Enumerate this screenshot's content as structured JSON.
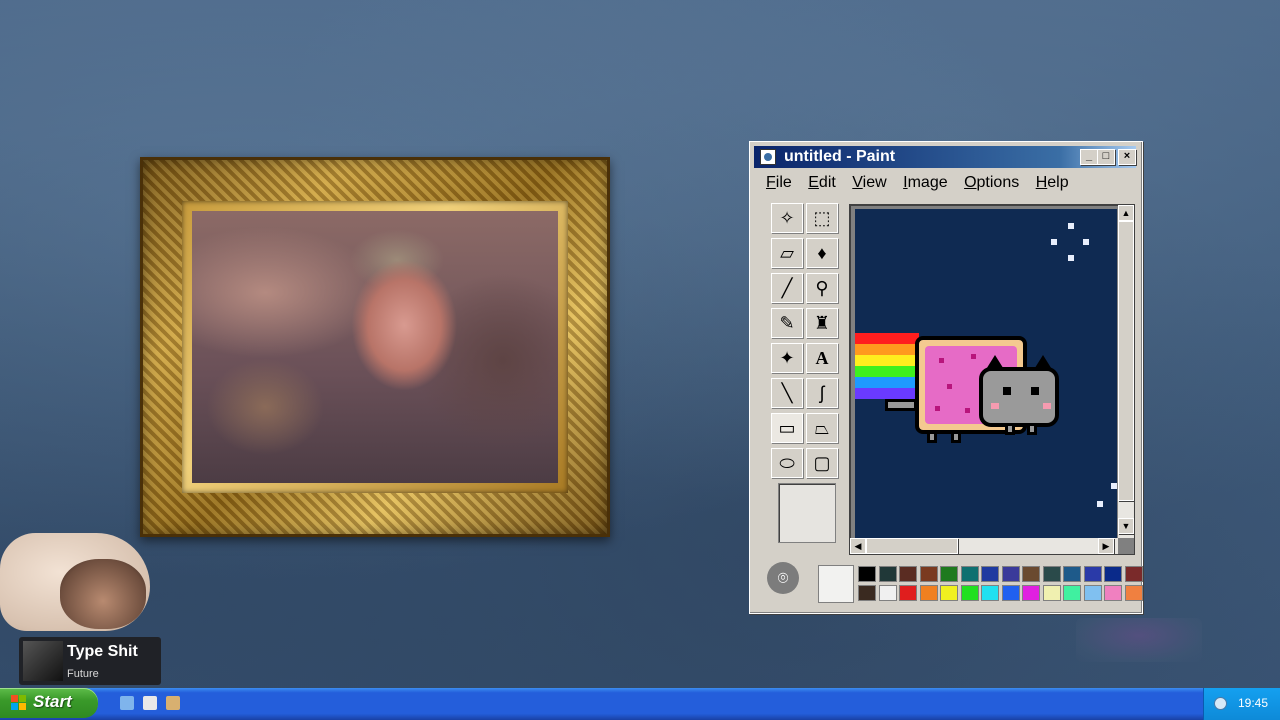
{
  "wallpaper": {
    "color": "#3f5b7a"
  },
  "frame": {
    "photo_alt": "framed photo"
  },
  "paint": {
    "title": "untitled - Paint",
    "menus": [
      "File",
      "Edit",
      "View",
      "Image",
      "Options",
      "Help"
    ],
    "tools": [
      "free-select",
      "rect-select",
      "eraser",
      "fill",
      "color-picker",
      "magnifier",
      "pencil",
      "brush",
      "airbrush",
      "text",
      "line",
      "curve",
      "rectangle",
      "polygon",
      "ellipse",
      "rounded-rectangle"
    ],
    "canvas_color": "#0f2a52",
    "palette": {
      "row1": [
        "#000000",
        "#203838",
        "#5a2c22",
        "#7a3a20",
        "#1e7a1e",
        "#0e7070",
        "#1e3aa0",
        "#3a3a9a",
        "#6a4a30",
        "#2a4a4a",
        "#1e5a8a",
        "#2a3aa8",
        "#0a2a8a",
        "#7a2a2a"
      ],
      "row2": [
        "#3a2a20",
        "#f0f0f0",
        "#e01e1e",
        "#f08020",
        "#f0f020",
        "#20e020",
        "#20e0f0",
        "#2060f0",
        "#e020e0",
        "#f0f0b0",
        "#40f0a0",
        "#80c0f0",
        "#f080c0",
        "#f08040"
      ]
    }
  },
  "now_playing": {
    "song": "Type Shit",
    "artist": "Future"
  },
  "taskbar": {
    "start_label": "Start",
    "clock": "19:45"
  }
}
